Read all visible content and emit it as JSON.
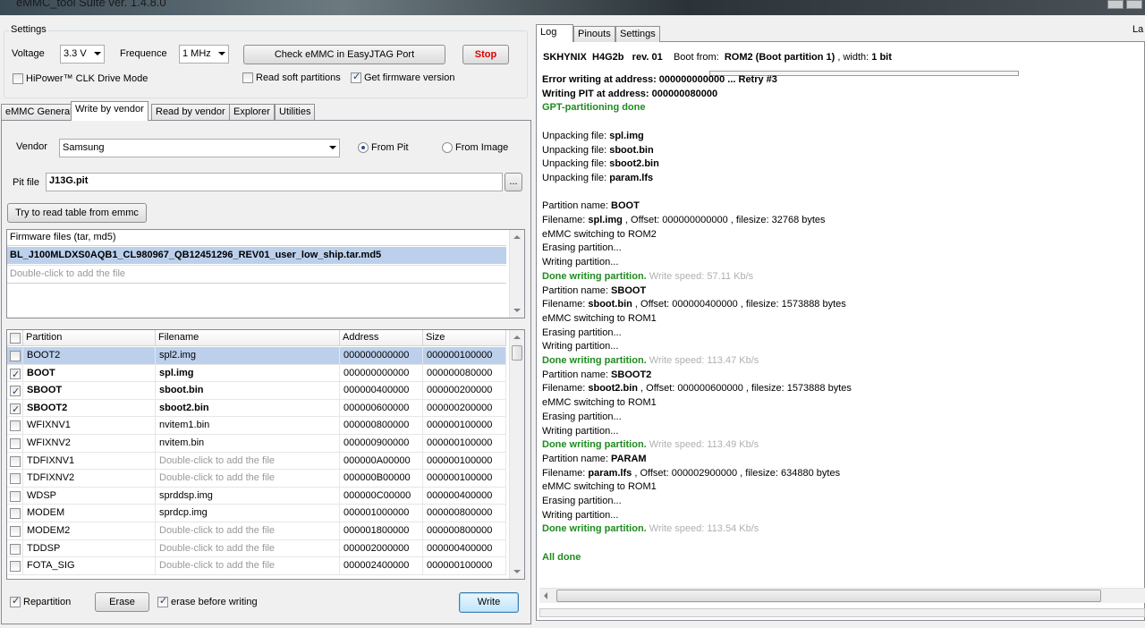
{
  "window": {
    "title": "eMMC_tool Suite  ver. 1.4.8.0"
  },
  "settings": {
    "group_label": "Settings",
    "voltage_label": "Voltage",
    "voltage_value": "3.3 V",
    "frequence_label": "Frequence",
    "frequence_value": "1 MHz",
    "check_button": "Check eMMC in EasyJTAG Port",
    "stop_button": "Stop",
    "hipower_label": "HiPower™ CLK Drive Mode",
    "hipower_checked": false,
    "read_soft_label": "Read soft partitions",
    "read_soft_checked": false,
    "get_fw_label": "Get firmware version",
    "get_fw_checked": true
  },
  "left_tabs": [
    "eMMC General",
    "Write by vendor",
    "Read by vendor",
    "Explorer",
    "Utilities"
  ],
  "left_active_tab": "Write by vendor",
  "write": {
    "vendor_label": "Vendor",
    "vendor_value": "Samsung",
    "from_pit_label": "From Pit",
    "from_image_label": "From Image",
    "pit_label": "Pit file",
    "pit_value": "J13G.pit",
    "browse_label": "...",
    "read_table_button": "Try to read table from emmc",
    "fw_header": "Firmware files (tar, md5)",
    "fw_files": [
      "BL_J100MLDXS0AQB1_CL980967_QB12451296_REV01_user_low_ship.tar.md5"
    ],
    "fw_hint": "Double-click to add the file"
  },
  "table": {
    "columns": [
      "Partition",
      "Filename",
      "Address",
      "Size"
    ],
    "rows": [
      {
        "checked": false,
        "partition": "BOOT2",
        "filename": "spl2.img",
        "address": "000000000000",
        "size": "000000100000",
        "bold": false,
        "hint": false,
        "selected": true
      },
      {
        "checked": true,
        "partition": "BOOT",
        "filename": "spl.img",
        "address": "000000000000",
        "size": "000000080000",
        "bold": true,
        "hint": false,
        "selected": false
      },
      {
        "checked": true,
        "partition": "SBOOT",
        "filename": "sboot.bin",
        "address": "000000400000",
        "size": "000000200000",
        "bold": true,
        "hint": false,
        "selected": false
      },
      {
        "checked": true,
        "partition": "SBOOT2",
        "filename": "sboot2.bin",
        "address": "000000600000",
        "size": "000000200000",
        "bold": true,
        "hint": false,
        "selected": false
      },
      {
        "checked": false,
        "partition": "WFIXNV1",
        "filename": "nvitem1.bin",
        "address": "000000800000",
        "size": "000000100000",
        "bold": false,
        "hint": false,
        "selected": false
      },
      {
        "checked": false,
        "partition": "WFIXNV2",
        "filename": "nvitem.bin",
        "address": "000000900000",
        "size": "000000100000",
        "bold": false,
        "hint": false,
        "selected": false
      },
      {
        "checked": false,
        "partition": "TDFIXNV1",
        "filename": "Double-click to add the file",
        "address": "000000A00000",
        "size": "000000100000",
        "bold": false,
        "hint": true,
        "selected": false
      },
      {
        "checked": false,
        "partition": "TDFIXNV2",
        "filename": "Double-click to add the file",
        "address": "000000B00000",
        "size": "000000100000",
        "bold": false,
        "hint": true,
        "selected": false
      },
      {
        "checked": false,
        "partition": "WDSP",
        "filename": "sprddsp.img",
        "address": "000000C00000",
        "size": "000000400000",
        "bold": false,
        "hint": false,
        "selected": false
      },
      {
        "checked": false,
        "partition": "MODEM",
        "filename": "sprdcp.img",
        "address": "000001000000",
        "size": "000000800000",
        "bold": false,
        "hint": false,
        "selected": false
      },
      {
        "checked": false,
        "partition": "MODEM2",
        "filename": "Double-click to add the file",
        "address": "000001800000",
        "size": "000000800000",
        "bold": false,
        "hint": true,
        "selected": false
      },
      {
        "checked": false,
        "partition": "TDDSP",
        "filename": "Double-click to add the file",
        "address": "000002000000",
        "size": "000000400000",
        "bold": false,
        "hint": true,
        "selected": false
      },
      {
        "checked": false,
        "partition": "FOTA_SIG",
        "filename": "Double-click to add the file",
        "address": "000002400000",
        "size": "000000100000",
        "bold": false,
        "hint": true,
        "selected": false
      }
    ]
  },
  "bottom": {
    "repartition_label": "Repartition",
    "repartition_checked": true,
    "erase_button": "Erase",
    "erase_before_label": "erase before writing",
    "erase_before_checked": true,
    "write_button": "Write"
  },
  "right_tabs": [
    "Log",
    "Pinouts",
    "Settings"
  ],
  "right_extra": "La",
  "device": {
    "vendor": "SKHYNIX",
    "model": "H4G2b",
    "rev": "rev. 01",
    "boot_label": "Boot from:",
    "boot_value": "ROM2 (Boot partition 1)",
    "width_label": ", width:",
    "width_value": "1 bit"
  },
  "log": [
    [
      [
        "b",
        "Error writing at address: 000000000000 ... Retry #3"
      ]
    ],
    [
      [
        "b",
        "Writing PIT at address: 000000080000"
      ]
    ],
    [
      [
        "g",
        "GPT-partitioning done"
      ]
    ],
    [],
    [
      [
        "n",
        "Unpacking file: "
      ],
      [
        "b",
        "spl.img"
      ]
    ],
    [
      [
        "n",
        "Unpacking file: "
      ],
      [
        "b",
        "sboot.bin"
      ]
    ],
    [
      [
        "n",
        "Unpacking file: "
      ],
      [
        "b",
        "sboot2.bin"
      ]
    ],
    [
      [
        "n",
        "Unpacking file: "
      ],
      [
        "b",
        "param.lfs"
      ]
    ],
    [],
    [
      [
        "n",
        "Partition name: "
      ],
      [
        "b",
        "BOOT"
      ]
    ],
    [
      [
        "n",
        "Filename: "
      ],
      [
        "b",
        "spl.img"
      ],
      [
        "n",
        " , Offset: 000000000000 , filesize: 32768 bytes"
      ]
    ],
    [
      [
        "n",
        "eMMC switching to ROM2"
      ]
    ],
    [
      [
        "n",
        "Erasing partition..."
      ]
    ],
    [
      [
        "n",
        "Writing partition..."
      ]
    ],
    [
      [
        "g",
        "Done writing partition."
      ],
      [
        "s",
        " Write speed: 57.11 Kb/s"
      ]
    ],
    [
      [
        "n",
        "Partition name: "
      ],
      [
        "b",
        "SBOOT"
      ]
    ],
    [
      [
        "n",
        "Filename: "
      ],
      [
        "b",
        "sboot.bin"
      ],
      [
        "n",
        " , Offset: 000000400000 , filesize: 1573888 bytes"
      ]
    ],
    [
      [
        "n",
        "eMMC switching to ROM1"
      ]
    ],
    [
      [
        "n",
        "Erasing partition..."
      ]
    ],
    [
      [
        "n",
        "Writing partition..."
      ]
    ],
    [
      [
        "g",
        "Done writing partition."
      ],
      [
        "s",
        " Write speed: 113.47 Kb/s"
      ]
    ],
    [
      [
        "n",
        "Partition name: "
      ],
      [
        "b",
        "SBOOT2"
      ]
    ],
    [
      [
        "n",
        "Filename: "
      ],
      [
        "b",
        "sboot2.bin"
      ],
      [
        "n",
        " , Offset: 000000600000 , filesize: 1573888 bytes"
      ]
    ],
    [
      [
        "n",
        "eMMC switching to ROM1"
      ]
    ],
    [
      [
        "n",
        "Erasing partition..."
      ]
    ],
    [
      [
        "n",
        "Writing partition..."
      ]
    ],
    [
      [
        "g",
        "Done writing partition."
      ],
      [
        "s",
        " Write speed: 113.49 Kb/s"
      ]
    ],
    [
      [
        "n",
        "Partition name: "
      ],
      [
        "b",
        "PARAM"
      ]
    ],
    [
      [
        "n",
        "Filename: "
      ],
      [
        "b",
        "param.lfs"
      ],
      [
        "n",
        " , Offset: 000002900000 , filesize: 634880 bytes"
      ]
    ],
    [
      [
        "n",
        "eMMC switching to ROM1"
      ]
    ],
    [
      [
        "n",
        "Erasing partition..."
      ]
    ],
    [
      [
        "n",
        "Writing partition..."
      ]
    ],
    [
      [
        "g",
        "Done writing partition."
      ],
      [
        "s",
        " Write speed: 113.54 Kb/s"
      ]
    ],
    [],
    [
      [
        "g",
        "All done"
      ]
    ]
  ]
}
